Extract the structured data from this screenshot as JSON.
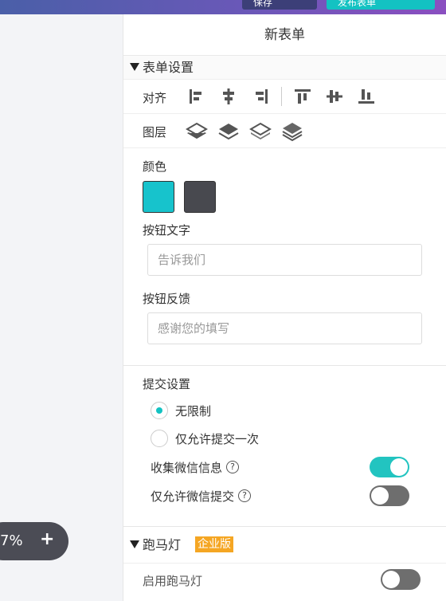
{
  "topbar": {
    "left_button": "保存",
    "right_button": "发布表单"
  },
  "zoom": {
    "value": "7%",
    "plus_label": "+"
  },
  "panel": {
    "title": "新表单"
  },
  "form_settings": {
    "section_title": "表单设置",
    "align_label": "对齐",
    "layer_label": "图层",
    "align_icons": [
      "align-left-icon",
      "align-center-h-icon",
      "align-right-icon",
      "align-top-icon",
      "align-middle-v-icon",
      "align-bottom-icon"
    ],
    "layer_icons": [
      "layer-top-icon",
      "layer-up-icon",
      "layer-down-icon",
      "layer-bottom-icon"
    ],
    "color_label": "颜色",
    "colors": {
      "primary": "#17c3cc",
      "secondary": "#48494f"
    },
    "button_text_label": "按钮文字",
    "button_text_placeholder": "告诉我们",
    "button_feedback_label": "按钮反馈",
    "button_feedback_placeholder": "感谢您的填写"
  },
  "submit_settings": {
    "title": "提交设置",
    "option_unlimited": "无限制",
    "option_once": "仅允许提交一次",
    "collect_wechat": "收集微信信息",
    "wechat_only": "仅允许微信提交",
    "collect_wechat_on": true,
    "wechat_only_on": false
  },
  "marquee": {
    "title": "跑马灯",
    "badge": "企业版",
    "enable_label": "启用跑马灯"
  }
}
